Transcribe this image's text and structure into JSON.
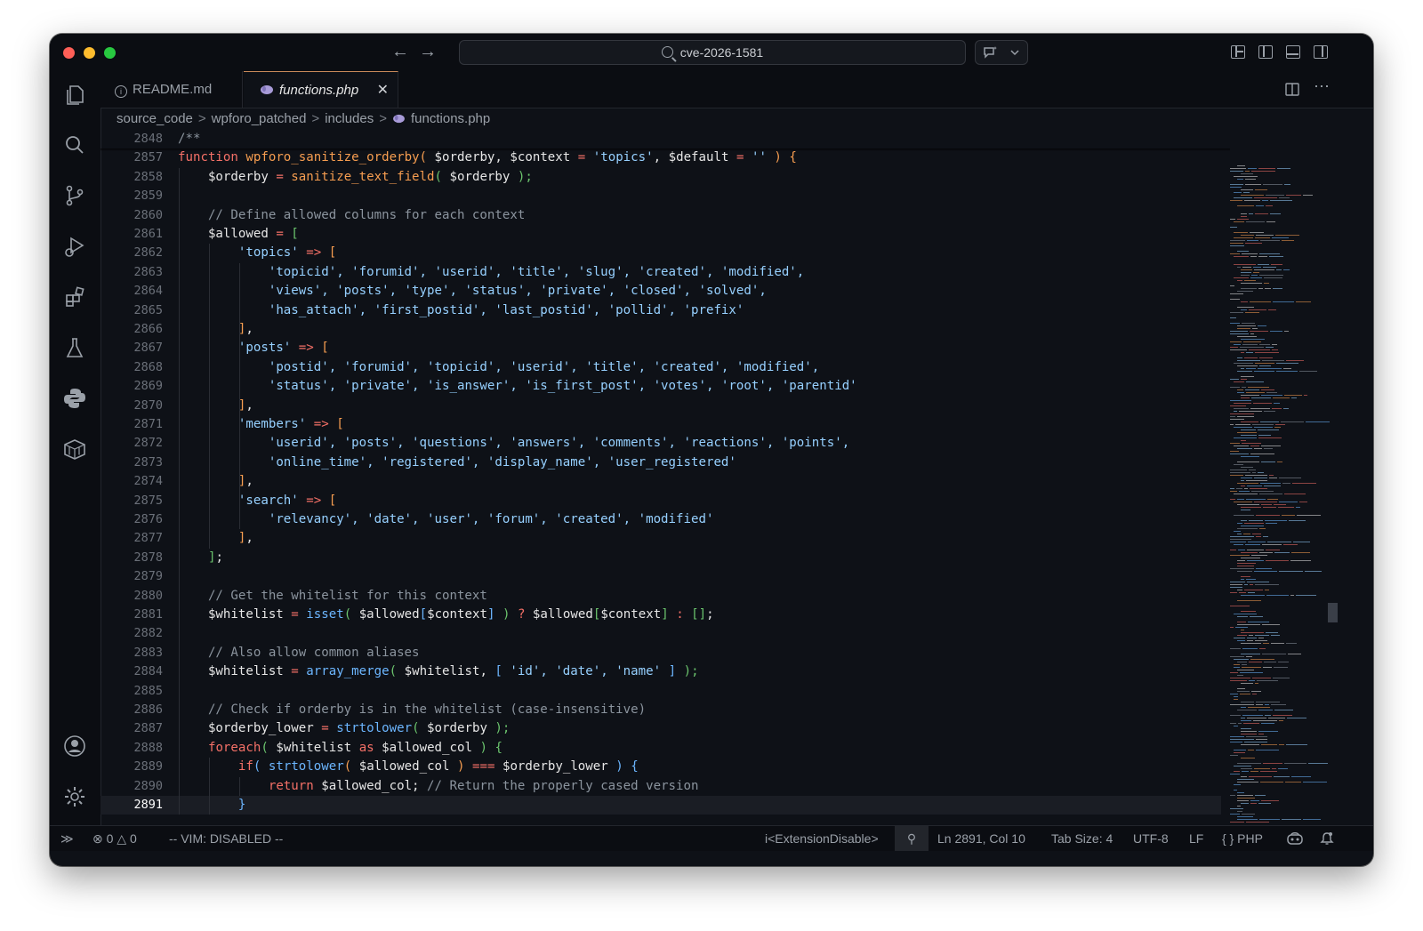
{
  "window": {
    "search_text": "cve-2026-1581"
  },
  "tabs": [
    {
      "label": "README.md",
      "icon": "info-icon"
    },
    {
      "label": "functions.php",
      "icon": "php-elephant-icon",
      "active": true
    }
  ],
  "breadcrumb": {
    "items": [
      "source_code",
      "wpforo_patched",
      "includes",
      "functions.php"
    ],
    "separator": ">"
  },
  "editor": {
    "sticky_line": {
      "number": "2848",
      "text": "/**"
    },
    "current_line": "2891",
    "lines": [
      {
        "n": "2857"
      },
      {
        "n": "2858"
      },
      {
        "n": "2859"
      },
      {
        "n": "2860"
      },
      {
        "n": "2861"
      },
      {
        "n": "2862"
      },
      {
        "n": "2863"
      },
      {
        "n": "2864"
      },
      {
        "n": "2865"
      },
      {
        "n": "2866"
      },
      {
        "n": "2867"
      },
      {
        "n": "2868"
      },
      {
        "n": "2869"
      },
      {
        "n": "2870"
      },
      {
        "n": "2871"
      },
      {
        "n": "2872"
      },
      {
        "n": "2873"
      },
      {
        "n": "2874"
      },
      {
        "n": "2875"
      },
      {
        "n": "2876"
      },
      {
        "n": "2877"
      },
      {
        "n": "2878"
      },
      {
        "n": "2879"
      },
      {
        "n": "2880"
      },
      {
        "n": "2881"
      },
      {
        "n": "2882"
      },
      {
        "n": "2883"
      },
      {
        "n": "2884"
      },
      {
        "n": "2885"
      },
      {
        "n": "2886"
      },
      {
        "n": "2887"
      },
      {
        "n": "2888"
      },
      {
        "n": "2889"
      },
      {
        "n": "2890"
      },
      {
        "n": "2891"
      }
    ],
    "code": [
      [
        [
          "function ",
          "k"
        ],
        [
          "wpforo_sanitize_orderby",
          "f"
        ],
        [
          "( ",
          "b1"
        ],
        [
          "$orderby, $context ",
          "v"
        ],
        [
          "= ",
          "op"
        ],
        [
          "'topics'",
          "s"
        ],
        [
          ", $default ",
          "v"
        ],
        [
          "= ",
          "op"
        ],
        [
          "''",
          "s"
        ],
        [
          " ) {",
          "b1"
        ]
      ],
      [
        [
          "    $orderby ",
          "v"
        ],
        [
          "= ",
          "op"
        ],
        [
          "sanitize_text_field",
          "f"
        ],
        [
          "( ",
          "b2"
        ],
        [
          "$orderby ",
          "v"
        ],
        [
          ");",
          "b2"
        ]
      ],
      [],
      [
        [
          "    // Define allowed columns for each context",
          "c"
        ]
      ],
      [
        [
          "    $allowed ",
          "v"
        ],
        [
          "= ",
          "op"
        ],
        [
          "[",
          "b2"
        ]
      ],
      [
        [
          "        ",
          "v"
        ],
        [
          "'topics'",
          "s"
        ],
        [
          " => ",
          "op"
        ],
        [
          "[",
          "b1"
        ]
      ],
      [
        [
          "            ",
          "v"
        ],
        [
          "'topicid', 'forumid', 'userid', 'title', 'slug', 'created', 'modified',",
          "s"
        ]
      ],
      [
        [
          "            ",
          "v"
        ],
        [
          "'views', 'posts', 'type', 'status', 'private', 'closed', 'solved',",
          "s"
        ]
      ],
      [
        [
          "            ",
          "v"
        ],
        [
          "'has_attach', 'first_postid', 'last_postid', 'pollid', 'prefix'",
          "s"
        ]
      ],
      [
        [
          "        ",
          "v"
        ],
        [
          "]",
          "b1"
        ],
        [
          ",",
          "v"
        ]
      ],
      [
        [
          "        ",
          "v"
        ],
        [
          "'posts'",
          "s"
        ],
        [
          " => ",
          "op"
        ],
        [
          "[",
          "b1"
        ]
      ],
      [
        [
          "            ",
          "v"
        ],
        [
          "'postid', 'forumid', 'topicid', 'userid', 'title', 'created', 'modified',",
          "s"
        ]
      ],
      [
        [
          "            ",
          "v"
        ],
        [
          "'status', 'private', 'is_answer', 'is_first_post', 'votes', 'root', 'parentid'",
          "s"
        ]
      ],
      [
        [
          "        ",
          "v"
        ],
        [
          "]",
          "b1"
        ],
        [
          ",",
          "v"
        ]
      ],
      [
        [
          "        ",
          "v"
        ],
        [
          "'members'",
          "s"
        ],
        [
          " => ",
          "op"
        ],
        [
          "[",
          "b1"
        ]
      ],
      [
        [
          "            ",
          "v"
        ],
        [
          "'userid', 'posts', 'questions', 'answers', 'comments', 'reactions', 'points',",
          "s"
        ]
      ],
      [
        [
          "            ",
          "v"
        ],
        [
          "'online_time', 'registered', 'display_name', 'user_registered'",
          "s"
        ]
      ],
      [
        [
          "        ",
          "v"
        ],
        [
          "]",
          "b1"
        ],
        [
          ",",
          "v"
        ]
      ],
      [
        [
          "        ",
          "v"
        ],
        [
          "'search'",
          "s"
        ],
        [
          " => ",
          "op"
        ],
        [
          "[",
          "b1"
        ]
      ],
      [
        [
          "            ",
          "v"
        ],
        [
          "'relevancy', 'date', 'user', 'forum', 'created', 'modified'",
          "s"
        ]
      ],
      [
        [
          "        ",
          "v"
        ],
        [
          "]",
          "b1"
        ],
        [
          ",",
          "v"
        ]
      ],
      [
        [
          "    ",
          "v"
        ],
        [
          "]",
          "b2"
        ],
        [
          ";",
          "v"
        ]
      ],
      [],
      [
        [
          "    // Get the whitelist for this context",
          "c"
        ]
      ],
      [
        [
          "    $whitelist ",
          "v"
        ],
        [
          "= ",
          "op"
        ],
        [
          "isset",
          "fb"
        ],
        [
          "( ",
          "b2"
        ],
        [
          "$allowed",
          "v"
        ],
        [
          "[",
          "b3"
        ],
        [
          "$context",
          "v"
        ],
        [
          "]",
          "b3"
        ],
        [
          " ) ",
          "b2"
        ],
        [
          "? ",
          "op"
        ],
        [
          "$allowed",
          "v"
        ],
        [
          "[",
          "b2"
        ],
        [
          "$context",
          "v"
        ],
        [
          "]",
          "b2"
        ],
        [
          " : ",
          "op"
        ],
        [
          "[]",
          "b2"
        ],
        [
          ";",
          "v"
        ]
      ],
      [],
      [
        [
          "    // Also allow common aliases",
          "c"
        ]
      ],
      [
        [
          "    $whitelist ",
          "v"
        ],
        [
          "= ",
          "op"
        ],
        [
          "array_merge",
          "fb"
        ],
        [
          "( ",
          "b2"
        ],
        [
          "$whitelist, ",
          "v"
        ],
        [
          "[ ",
          "b3"
        ],
        [
          "'id', 'date', 'name'",
          "s"
        ],
        [
          " ] ",
          "b3"
        ],
        [
          ");",
          "b2"
        ]
      ],
      [],
      [
        [
          "    // Check if orderby is in the whitelist (case-insensitive)",
          "c"
        ]
      ],
      [
        [
          "    $orderby_lower ",
          "v"
        ],
        [
          "= ",
          "op"
        ],
        [
          "strtolower",
          "fb"
        ],
        [
          "( ",
          "b2"
        ],
        [
          "$orderby ",
          "v"
        ],
        [
          ");",
          "b2"
        ]
      ],
      [
        [
          "    ",
          "v"
        ],
        [
          "foreach",
          "k"
        ],
        [
          "( ",
          "b2"
        ],
        [
          "$whitelist ",
          "v"
        ],
        [
          "as ",
          "k"
        ],
        [
          "$allowed_col ",
          "v"
        ],
        [
          ") {",
          "b2"
        ]
      ],
      [
        [
          "        ",
          "v"
        ],
        [
          "if",
          "k"
        ],
        [
          "( ",
          "b3"
        ],
        [
          "strtolower",
          "fb"
        ],
        [
          "( ",
          "b1"
        ],
        [
          "$allowed_col ",
          "v"
        ],
        [
          ") ",
          "b1"
        ],
        [
          "=== ",
          "op"
        ],
        [
          "$orderby_lower ",
          "v"
        ],
        [
          ") {",
          "b3"
        ]
      ],
      [
        [
          "            ",
          "v"
        ],
        [
          "return ",
          "k"
        ],
        [
          "$allowed_col; ",
          "v"
        ],
        [
          "// Return the properly cased version",
          "c"
        ]
      ],
      [
        [
          "        ",
          "v"
        ],
        [
          "}",
          "b3"
        ]
      ]
    ]
  },
  "statusbar": {
    "errors": "0",
    "warnings": "0",
    "vim": "-- VIM: DISABLED --",
    "extension": "i<ExtensionDisable>",
    "position": "Ln 2891, Col 10",
    "tab_size": "Tab Size: 4",
    "encoding": "UTF-8",
    "eol": "LF",
    "language": "PHP"
  },
  "colors": {
    "keyword": "#f47067",
    "function": "#f69d50",
    "builtin": "#6cb6ff",
    "string": "#96d0ff",
    "comment": "#8b949e",
    "accent_tab_border": "#c98a5a"
  }
}
